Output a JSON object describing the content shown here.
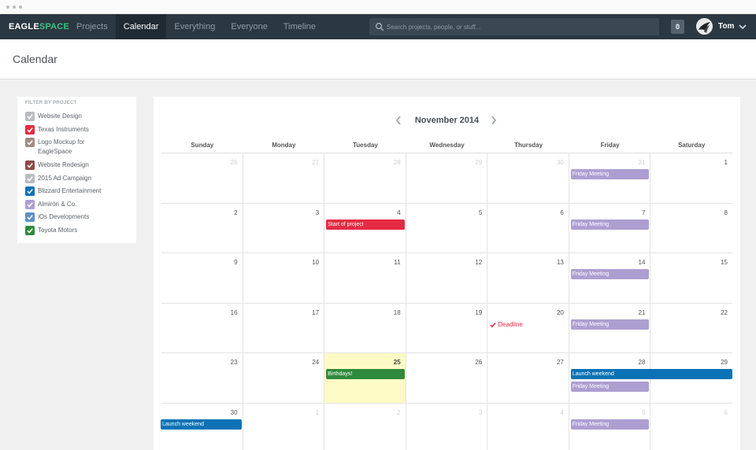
{
  "nav": {
    "logo_part1": "EAGLE",
    "logo_part2": "SPACE",
    "tabs": [
      {
        "label": "Projects",
        "active": false
      },
      {
        "label": "Calendar",
        "active": true
      },
      {
        "label": "Everything",
        "active": false
      },
      {
        "label": "Everyone",
        "active": false
      },
      {
        "label": "Timeline",
        "active": false
      }
    ],
    "search_placeholder": "Search projects, people, or stuff...",
    "notification_count": "0",
    "username": "Tom"
  },
  "page": {
    "title": "Calendar"
  },
  "filter": {
    "title": "FILTER BY PROJECT",
    "projects": [
      {
        "label": "Website Design",
        "color": "#b9bcbf"
      },
      {
        "label": "Texas Instruments",
        "color": "#e42b43"
      },
      {
        "label": "Logo Mockup for EagleSpace",
        "color": "#a08b7f"
      },
      {
        "label": "Website Redesign",
        "color": "#8c4b46"
      },
      {
        "label": "2015 Ad Campaign",
        "color": "#b9bcbf"
      },
      {
        "label": "Blizzard Entertainment",
        "color": "#0b72b5"
      },
      {
        "label": "Almirón & Co.",
        "color": "#ad9ed2"
      },
      {
        "label": "iOs Developments",
        "color": "#5c8fc7"
      },
      {
        "label": "Toyota Motors",
        "color": "#2e8a3c"
      }
    ]
  },
  "calendar": {
    "month_label": "November 2014",
    "days_of_week": [
      "Sunday",
      "Monday",
      "Tuesday",
      "Wednesday",
      "Thursday",
      "Friday",
      "Saturday"
    ],
    "weeks": [
      [
        {
          "n": "26",
          "dim": true
        },
        {
          "n": "27",
          "dim": true
        },
        {
          "n": "28",
          "dim": true
        },
        {
          "n": "29",
          "dim": true
        },
        {
          "n": "30",
          "dim": true
        },
        {
          "n": "31",
          "dim": true
        },
        {
          "n": "1"
        }
      ],
      [
        {
          "n": "2"
        },
        {
          "n": "3"
        },
        {
          "n": "4"
        },
        {
          "n": "5"
        },
        {
          "n": "6"
        },
        {
          "n": "7"
        },
        {
          "n": "8"
        }
      ],
      [
        {
          "n": "9"
        },
        {
          "n": "10"
        },
        {
          "n": "11"
        },
        {
          "n": "12"
        },
        {
          "n": "13"
        },
        {
          "n": "14"
        },
        {
          "n": "15"
        }
      ],
      [
        {
          "n": "16"
        },
        {
          "n": "17"
        },
        {
          "n": "18"
        },
        {
          "n": "19"
        },
        {
          "n": "20"
        },
        {
          "n": "21"
        },
        {
          "n": "22"
        }
      ],
      [
        {
          "n": "23"
        },
        {
          "n": "24"
        },
        {
          "n": "25",
          "today": true
        },
        {
          "n": "26"
        },
        {
          "n": "27"
        },
        {
          "n": "28"
        },
        {
          "n": "29"
        }
      ],
      [
        {
          "n": "30"
        },
        {
          "n": "1",
          "dim": true
        },
        {
          "n": "2",
          "dim": true
        },
        {
          "n": "3",
          "dim": true
        },
        {
          "n": "4",
          "dim": true
        },
        {
          "n": "5",
          "dim": true
        },
        {
          "n": "6",
          "dim": true
        }
      ]
    ],
    "events": [
      {
        "week": 0,
        "day": 5,
        "span": 1,
        "slot": 0,
        "label": "Friday Meeting",
        "style": "lav"
      },
      {
        "week": 1,
        "day": 2,
        "span": 1,
        "slot": 0,
        "label": "Start of project",
        "style": "red"
      },
      {
        "week": 1,
        "day": 5,
        "span": 1,
        "slot": 0,
        "label": "Friday Meeting",
        "style": "lav"
      },
      {
        "week": 2,
        "day": 5,
        "span": 1,
        "slot": 0,
        "label": "Friday Meeting",
        "style": "lav"
      },
      {
        "week": 3,
        "day": 4,
        "span": 1,
        "slot": 0,
        "label": "Deadline",
        "style": "text"
      },
      {
        "week": 3,
        "day": 5,
        "span": 1,
        "slot": 0,
        "label": "Friday Meeting",
        "style": "lav"
      },
      {
        "week": 4,
        "day": 2,
        "span": 1,
        "slot": 0,
        "label": "Birthdays!",
        "style": "green"
      },
      {
        "week": 4,
        "day": 5,
        "span": 2,
        "slot": 0,
        "label": "Launch weekend",
        "style": "blue"
      },
      {
        "week": 4,
        "day": 5,
        "span": 1,
        "slot": 1,
        "label": "Friday Meeting",
        "style": "lav"
      },
      {
        "week": 5,
        "day": 0,
        "span": 1,
        "slot": 0,
        "label": "Launch weekend",
        "style": "blue"
      },
      {
        "week": 5,
        "day": 5,
        "span": 1,
        "slot": 0,
        "label": "Friday Meeting",
        "style": "lav"
      }
    ]
  }
}
